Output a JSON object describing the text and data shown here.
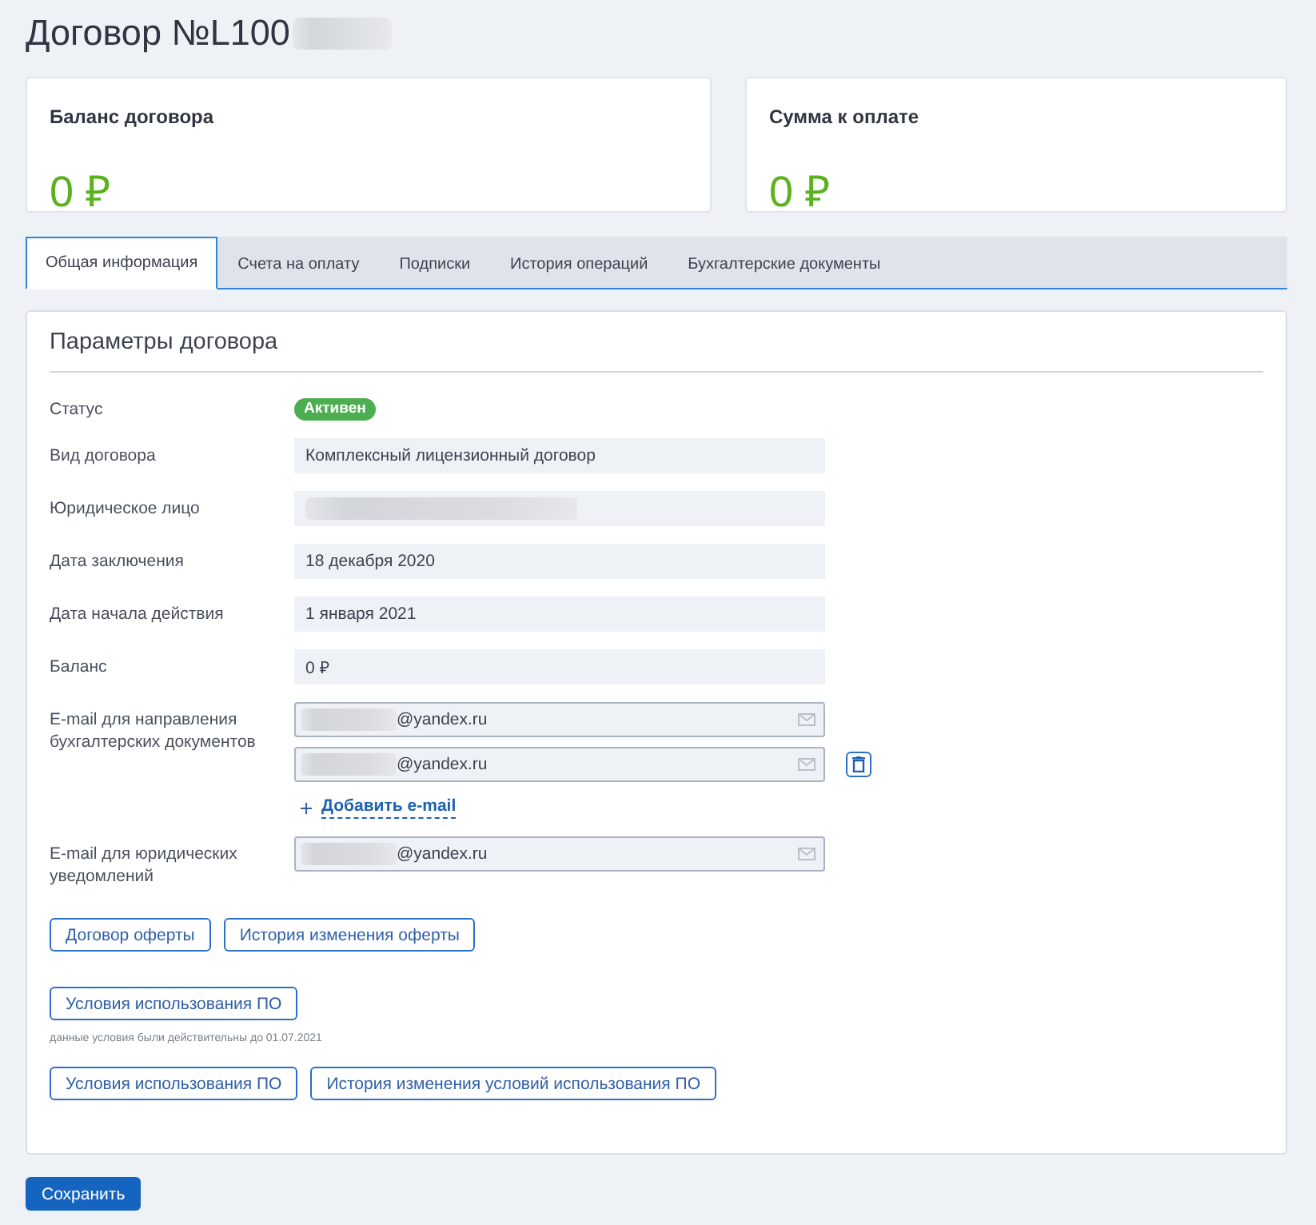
{
  "title": {
    "text": "Договор №L100",
    "redacted_suffix": true
  },
  "summary_cards": [
    {
      "label": "Баланс договора",
      "value": "0 ₽"
    },
    {
      "label": "Сумма к оплате",
      "value": "0 ₽"
    }
  ],
  "tabs": [
    {
      "label": "Общая информация",
      "selected": true
    },
    {
      "label": "Счета на оплату",
      "selected": false
    },
    {
      "label": "Подписки",
      "selected": false
    },
    {
      "label": "История операций",
      "selected": false
    },
    {
      "label": "Бухгалтерские документы",
      "selected": false
    }
  ],
  "section": {
    "title": "Параметры договора",
    "fields": [
      {
        "kind": "badge",
        "label": "Статус",
        "value": "Активен"
      },
      {
        "kind": "readonly",
        "label": "Вид договора",
        "value": "Комплексный лицензионный договор"
      },
      {
        "kind": "readonly",
        "label": "Юридическое лицо",
        "redacted": true
      },
      {
        "kind": "readonly",
        "label": "Дата заключения",
        "value": "18 декабря 2020"
      },
      {
        "kind": "readonly",
        "label": "Дата начала действия",
        "value": "1 января 2021"
      },
      {
        "kind": "readonly",
        "label": "Баланс",
        "value": "0 ₽"
      },
      {
        "kind": "email_list",
        "label": "E-mail для направления бухгалтерских документов",
        "emails": [
          {
            "value": "@yandex.ru",
            "redacted_prefix": true,
            "removable": false
          },
          {
            "value": "@yandex.ru",
            "redacted_prefix": true,
            "removable": true
          }
        ],
        "add_link": "Добавить e-mail"
      },
      {
        "kind": "email_list",
        "label": "E-mail для юридических уведомлений",
        "emails": [
          {
            "value": "@yandex.ru",
            "redacted_prefix": true,
            "removable": false
          }
        ]
      }
    ],
    "button_groups": [
      {
        "buttons": [
          "Договор оферты",
          "История изменения оферты"
        ]
      },
      {
        "buttons": [
          "Условия использования ПО"
        ],
        "note": "данные условия были действительны до 01.07.2021"
      },
      {
        "buttons": [
          "Условия использования ПО",
          "История изменения условий использования ПО"
        ]
      }
    ]
  },
  "save_button": "Сохранить"
}
